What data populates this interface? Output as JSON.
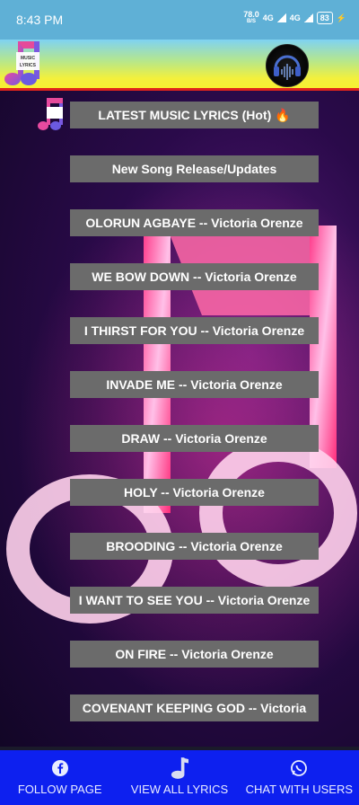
{
  "status_bar": {
    "time": "8:43 PM",
    "net_speed_value": "78.0",
    "net_speed_unit": "B/S",
    "network_1": "4G",
    "network_2": "4G",
    "battery": "83"
  },
  "header": {
    "logo_text_1": "MUSIC",
    "logo_text_2": "LYRICS"
  },
  "songs": [
    "LATEST MUSIC LYRICS (Hot) 🔥",
    "New Song Release/Updates",
    "OLORUN AGBAYE -- Victoria Orenze",
    "WE BOW DOWN -- Victoria Orenze",
    "I THIRST FOR YOU -- Victoria Orenze",
    "INVADE ME -- Victoria Orenze",
    "DRAW -- Victoria Orenze",
    "HOLY -- Victoria Orenze",
    "BROODING -- Victoria Orenze",
    "I WANT TO SEE YOU -- Victoria Orenze",
    "ON FIRE -- Victoria Orenze",
    "COVENANT KEEPING GOD -- Victoria"
  ],
  "bottom_nav": {
    "follow": "FOLLOW PAGE",
    "view_all": "VIEW ALL LYRICS",
    "chat": "CHAT WITH USERS"
  },
  "colors": {
    "status_bar": "#5fb0d6",
    "button": "#6b6b6b",
    "bottom_nav": "#0d20ef",
    "header_border": "#e0241c"
  }
}
